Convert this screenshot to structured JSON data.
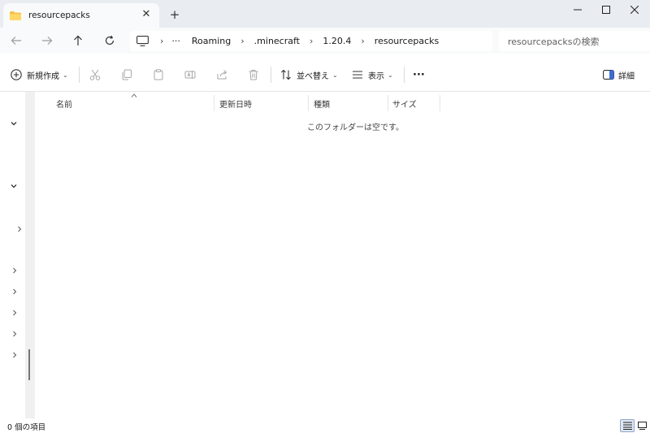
{
  "tab": {
    "title": "resourcepacks",
    "close": "✕",
    "new": "+"
  },
  "window": {
    "minimize": "—",
    "maximize": "☐",
    "close": "✕"
  },
  "breadcrumb": {
    "more": "···",
    "items": [
      "Roaming",
      ".minecraft",
      "1.20.4",
      "resourcepacks"
    ]
  },
  "search": {
    "placeholder": "resourcepacksの検索"
  },
  "toolbar": {
    "new_label": "新規作成",
    "sort_label": "並べ替え",
    "view_label": "表示",
    "more_label": "···",
    "details_label": "詳細"
  },
  "columns": {
    "name": "名前",
    "modified": "更新日時",
    "type": "種類",
    "size": "サイズ"
  },
  "empty_message": "このフォルダーは空です。",
  "status": {
    "items": "0 個の項目"
  }
}
